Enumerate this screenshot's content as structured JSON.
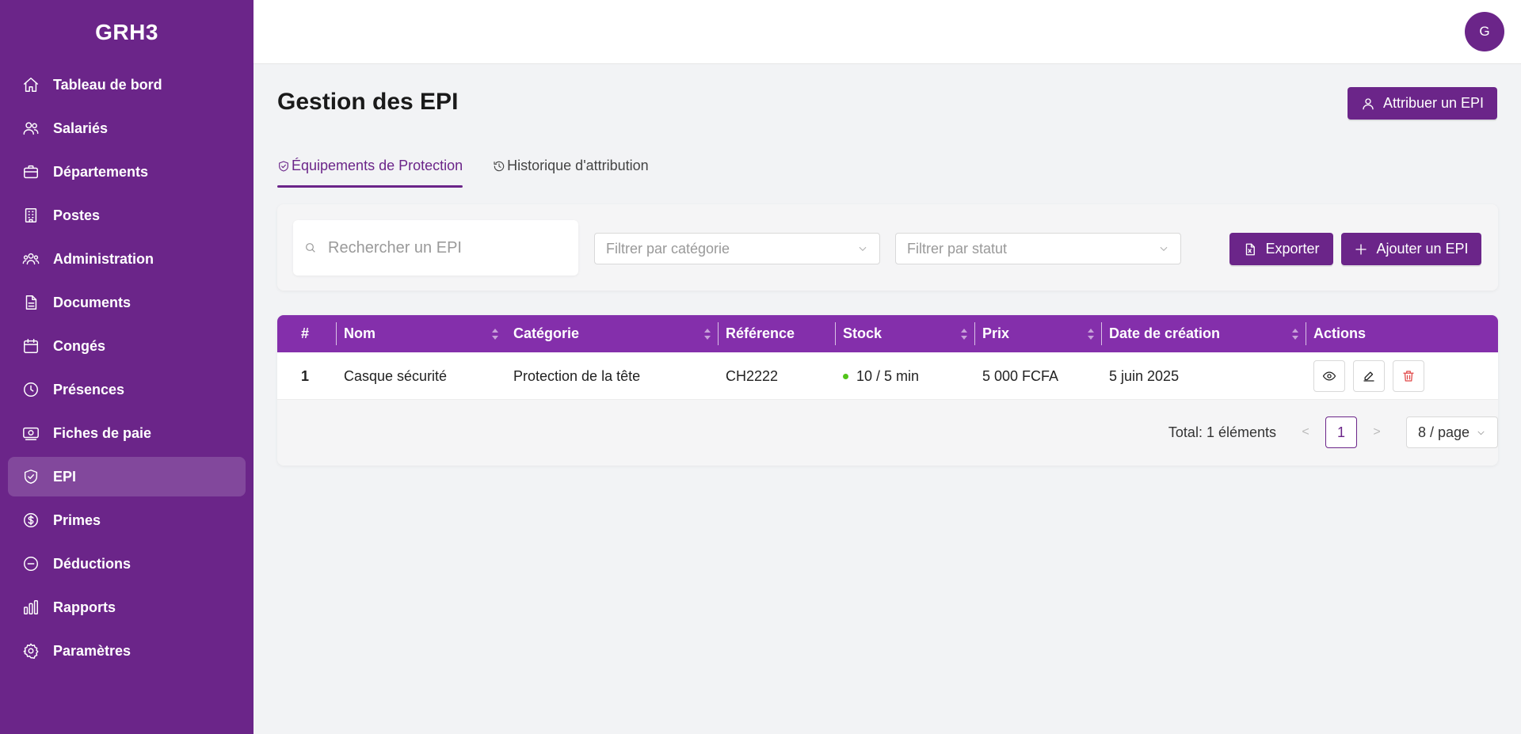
{
  "brand": "GRH3",
  "user_initial": "G",
  "nav": [
    {
      "label": "Tableau de bord",
      "icon": "home-icon"
    },
    {
      "label": "Salariés",
      "icon": "users-icon"
    },
    {
      "label": "Départements",
      "icon": "briefcase-icon"
    },
    {
      "label": "Postes",
      "icon": "building-icon"
    },
    {
      "label": "Administration",
      "icon": "team-icon"
    },
    {
      "label": "Documents",
      "icon": "document-icon"
    },
    {
      "label": "Congés",
      "icon": "calendar-icon"
    },
    {
      "label": "Présences",
      "icon": "clock-icon"
    },
    {
      "label": "Fiches de paie",
      "icon": "banknote-icon"
    },
    {
      "label": "EPI",
      "icon": "shield-icon",
      "active": true
    },
    {
      "label": "Primes",
      "icon": "dollar-circle-icon"
    },
    {
      "label": "Déductions",
      "icon": "minus-circle-icon"
    },
    {
      "label": "Rapports",
      "icon": "bar-chart-icon"
    },
    {
      "label": "Paramètres",
      "icon": "gear-icon"
    }
  ],
  "page": {
    "title": "Gestion des EPI",
    "assign_button": "Attribuer un EPI"
  },
  "tabs": [
    {
      "label": "Équipements de Protection",
      "icon": "shield-check-icon",
      "active": true
    },
    {
      "label": "Historique d'attribution",
      "icon": "history-icon"
    }
  ],
  "filters": {
    "search_placeholder": "Rechercher un EPI",
    "category_placeholder": "Filtrer par catégorie",
    "status_placeholder": "Filtrer par statut",
    "export_button": "Exporter",
    "add_button": "Ajouter un EPI"
  },
  "table": {
    "columns": [
      "#",
      "Nom",
      "Catégorie",
      "Référence",
      "Stock",
      "Prix",
      "Date de création",
      "Actions"
    ],
    "rows": [
      {
        "index": "1",
        "nom": "Casque sécurité",
        "categorie": "Protection de la tête",
        "reference": "CH2222",
        "stock": "10 / 5 min",
        "stock_status_color": "#52c41a",
        "prix": "5 000 FCFA",
        "date": "5 juin 2025"
      }
    ]
  },
  "pagination": {
    "total": "Total: 1 éléments",
    "current_page": "1",
    "page_size": "8 / page"
  },
  "colors": {
    "primary": "#6b2589",
    "table_header": "#842fab"
  }
}
